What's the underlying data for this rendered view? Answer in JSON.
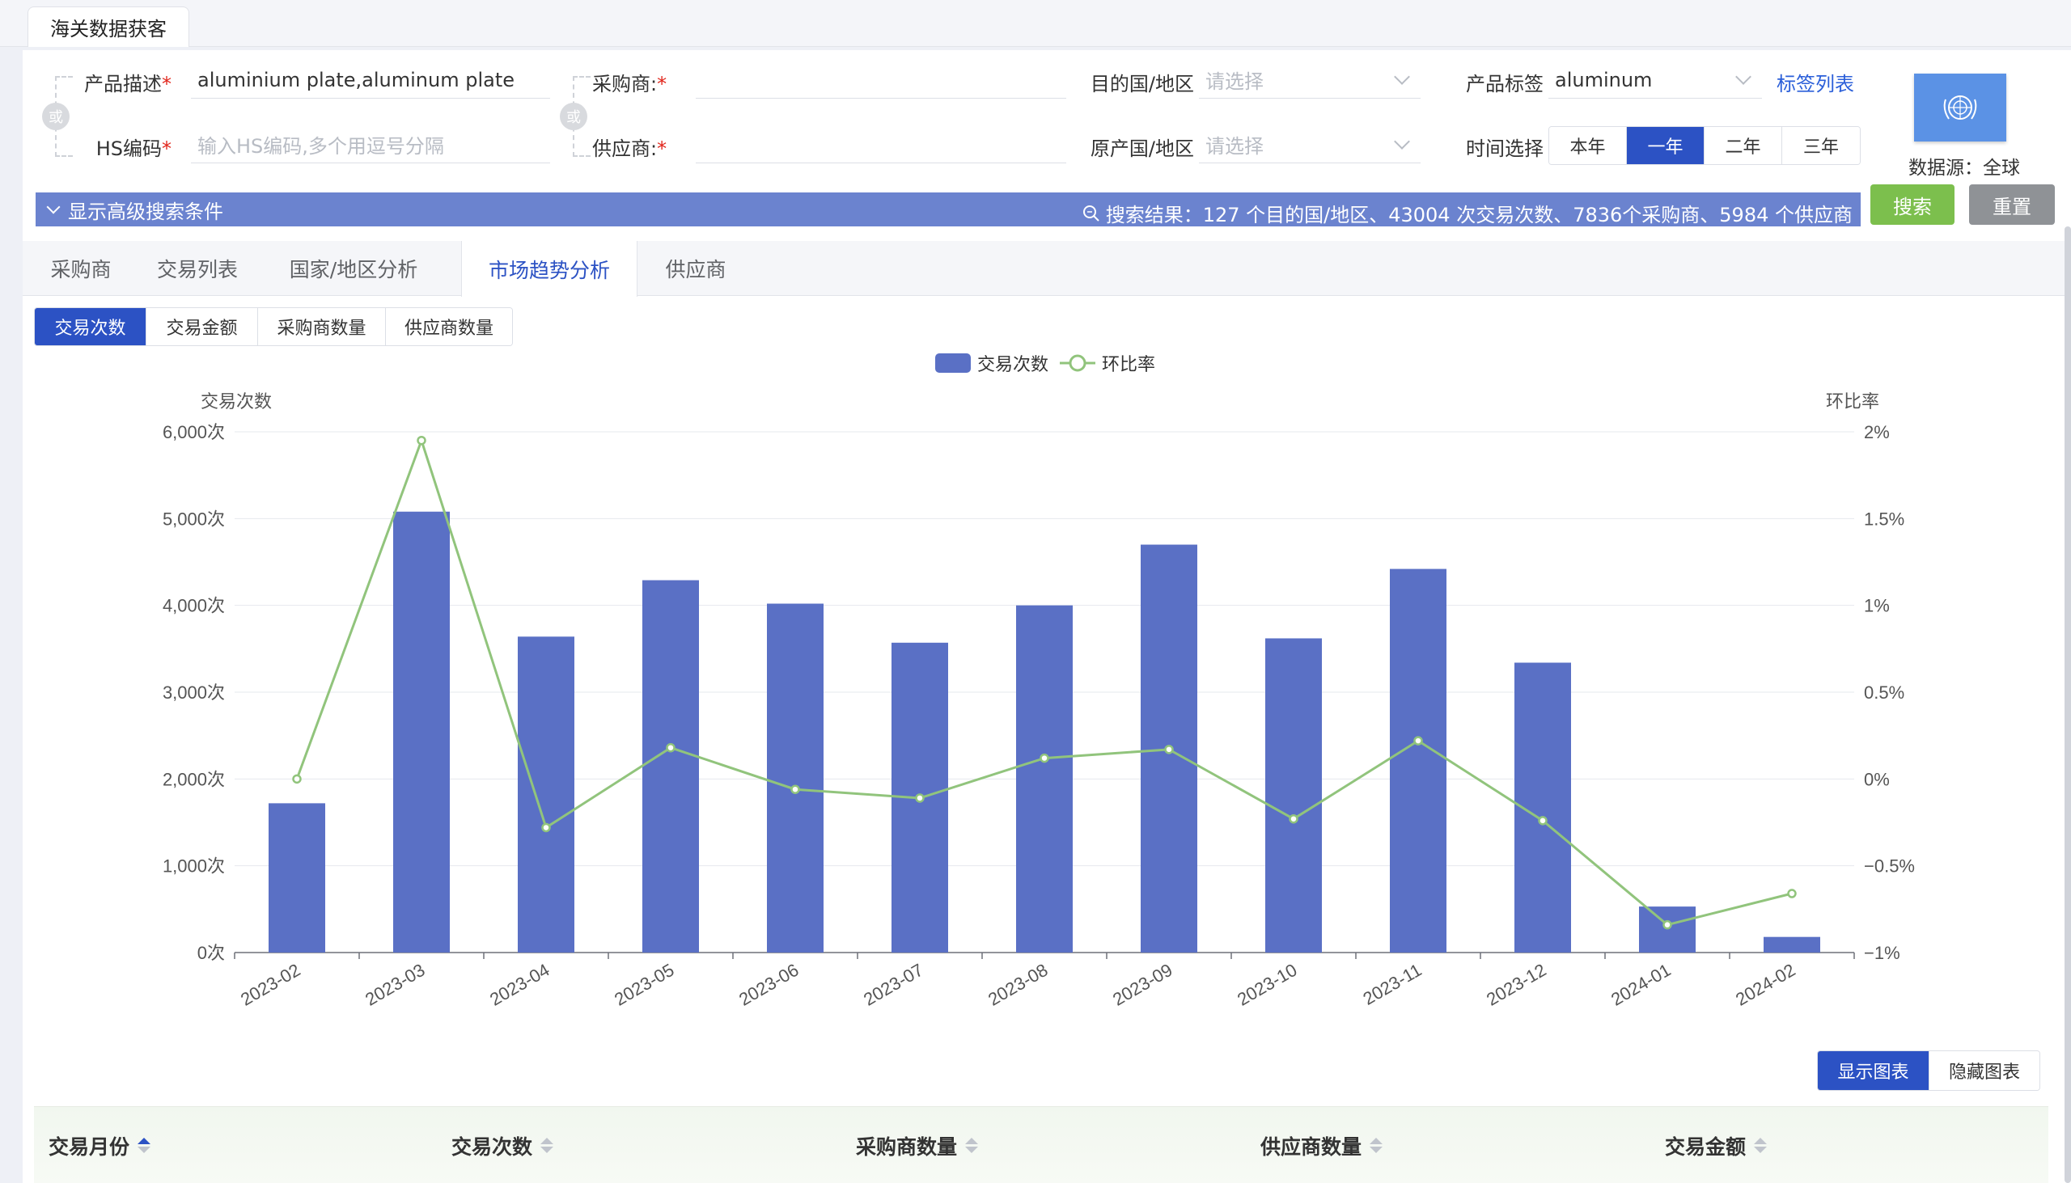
{
  "app": {
    "tab_title": "海关数据获客"
  },
  "search": {
    "product_desc_label": "产品描述",
    "product_desc_value": "aluminium plate,aluminum plate",
    "hs_label": "HS编码",
    "hs_placeholder": "输入HS编码,多个用逗号分隔",
    "or_label": "或",
    "required_mark": "*",
    "buyer_label": "采购商:",
    "supplier_label": "供应商:",
    "dest_label": "目的国/地区",
    "dest_placeholder": "请选择",
    "origin_label": "原产国/地区",
    "origin_placeholder": "请选择",
    "tag_label": "产品标签",
    "tag_value": "aluminum",
    "tag_list_link": "标签列表",
    "time_label": "时间选择",
    "time_options": [
      "本年",
      "一年",
      "二年",
      "三年"
    ],
    "time_selected_index": 1,
    "data_source": "数据源：全球",
    "advanced_toggle": "显示高级搜索条件",
    "result_summary": "搜索结果：127 个目的国/地区、43004 次交易次数、7836个采购商、5984 个供应商",
    "search_button": "搜索",
    "reset_button": "重置"
  },
  "tabs": [
    "采购商",
    "交易列表",
    "国家/地区分析",
    "市场趋势分析",
    "供应商"
  ],
  "active_tab_index": 3,
  "metric_tabs": [
    "交易次数",
    "交易金额",
    "采购商数量",
    "供应商数量"
  ],
  "active_metric_index": 0,
  "view_buttons": [
    "显示图表",
    "隐藏图表"
  ],
  "active_view_index": 0,
  "table_headers": [
    "交易月份",
    "交易次数",
    "采购商数量",
    "供应商数量",
    "交易金额"
  ],
  "colors": {
    "primary": "#2c52c4",
    "bar": "#5a70c5",
    "line": "#91c47c",
    "search_green": "#7cbf4d",
    "reset_gray": "#8f9296"
  },
  "chart_data": {
    "type": "bar",
    "categories": [
      "2023-02",
      "2023-03",
      "2023-04",
      "2023-05",
      "2023-06",
      "2023-07",
      "2023-08",
      "2023-09",
      "2023-10",
      "2023-11",
      "2023-12",
      "2024-01",
      "2024-02"
    ],
    "series": [
      {
        "name": "交易次数",
        "type": "bar",
        "axis": "left",
        "values": [
          1720,
          5080,
          3640,
          4290,
          4020,
          3570,
          4000,
          4700,
          3620,
          4420,
          3340,
          530,
          180
        ]
      },
      {
        "name": "环比率",
        "type": "line",
        "axis": "right",
        "values": [
          0.0,
          1.95,
          -0.28,
          0.18,
          -0.06,
          -0.11,
          0.12,
          0.17,
          -0.23,
          0.22,
          -0.24,
          -0.84,
          -0.66
        ]
      }
    ],
    "ylabel_left": "交易次数",
    "ylabel_right": "环比率",
    "ylim_left": [
      0,
      6000
    ],
    "ylim_right": [
      -1,
      2
    ],
    "yticks_left": [
      "0次",
      "1,000次",
      "2,000次",
      "3,000次",
      "4,000次",
      "5,000次",
      "6,000次"
    ],
    "yticks_right": [
      "−1%",
      "−0.5%",
      "0%",
      "0.5%",
      "1%",
      "1.5%",
      "2%"
    ],
    "legend": [
      "交易次数",
      "环比率"
    ],
    "legend_position": "top-center",
    "grid": true
  }
}
